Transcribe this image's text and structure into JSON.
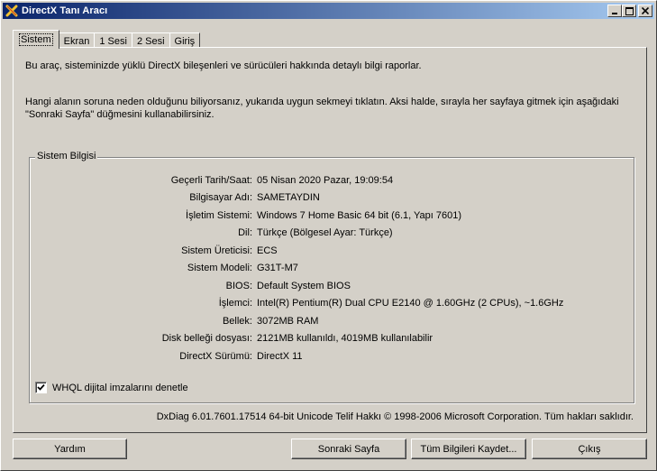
{
  "window": {
    "title": "DirectX Tanı Aracı",
    "minimize": "_",
    "maximize": "□",
    "close": "×"
  },
  "tabs": [
    {
      "label": "Sistem"
    },
    {
      "label": "Ekran"
    },
    {
      "label": "1 Sesi"
    },
    {
      "label": "2 Sesi"
    },
    {
      "label": "Giriş"
    }
  ],
  "intro": {
    "line1": "Bu araç, sisteminizde yüklü DirectX bileşenleri ve sürücüleri hakkında detaylı bilgi raporlar.",
    "line2": "Hangi alanın soruna neden olduğunu biliyorsanız, yukarıda uygun sekmeyi tıklatın.  Aksi halde, sırayla her sayfaya gitmek için aşağıdaki \"Sonraki Sayfa\" düğmesini kullanabilirsiniz."
  },
  "system_info": {
    "group_title": "Sistem Bilgisi",
    "rows": [
      {
        "label": "Geçerli Tarih/Saat:",
        "value": "05 Nisan 2020 Pazar, 19:09:54"
      },
      {
        "label": "Bilgisayar Adı:",
        "value": "SAMETAYDIN"
      },
      {
        "label": "İşletim Sistemi:",
        "value": "Windows 7 Home Basic 64 bit (6.1, Yapı 7601)"
      },
      {
        "label": "Dil:",
        "value": "Türkçe (Bölgesel Ayar: Türkçe)"
      },
      {
        "label": "Sistem Üreticisi:",
        "value": "ECS"
      },
      {
        "label": "Sistem Modeli:",
        "value": "G31T-M7"
      },
      {
        "label": "BIOS:",
        "value": "Default System BIOS"
      },
      {
        "label": "İşlemci:",
        "value": "Intel(R) Pentium(R) Dual  CPU  E2140  @ 1.60GHz (2 CPUs), ~1.6GHz"
      },
      {
        "label": "Bellek:",
        "value": "3072MB RAM"
      },
      {
        "label": "Disk belleği dosyası:",
        "value": "2121MB kullanıldı, 4019MB kullanılabilir"
      },
      {
        "label": "DirectX Sürümü:",
        "value": "DirectX 11"
      }
    ],
    "whql_label": "WHQL dijital imzalarını denetle",
    "whql_checked": true
  },
  "footer": {
    "copyright": "DxDiag 6.01.7601.17514 64-bit Unicode  Telif Hakkı © 1998-2006 Microsoft Corporation.  Tüm hakları saklıdır."
  },
  "buttons": {
    "help": "Yardım",
    "next_page": "Sonraki Sayfa",
    "save_all": "Tüm Bilgileri Kaydet...",
    "exit": "Çıkış"
  }
}
